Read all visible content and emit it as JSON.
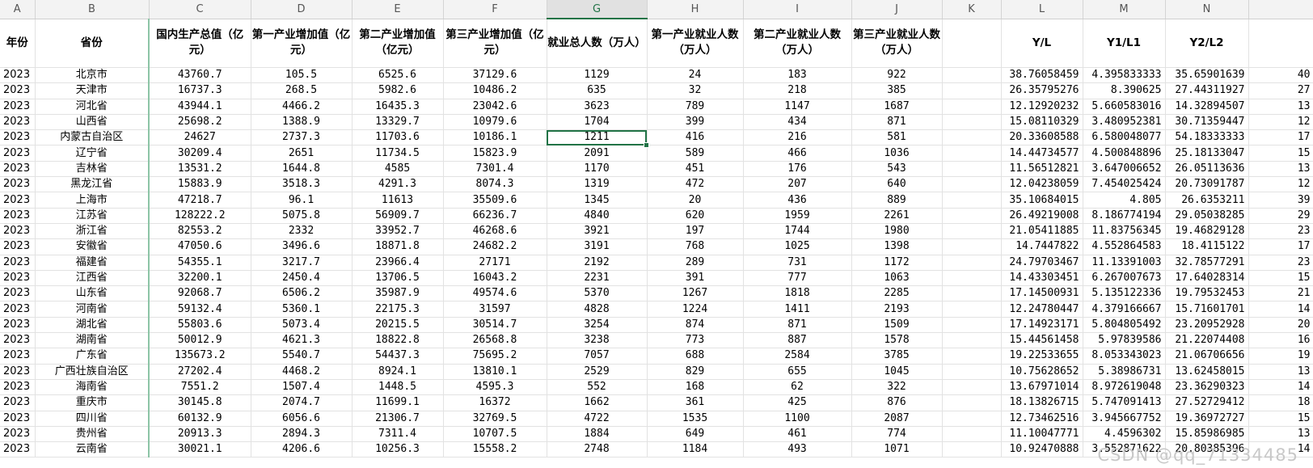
{
  "columns": [
    "A",
    "B",
    "C",
    "D",
    "E",
    "F",
    "G",
    "H",
    "I",
    "J",
    "K",
    "L",
    "M",
    "N"
  ],
  "headers": [
    "年份",
    "省份",
    "国内生产总值（亿元）",
    "第一产业增加值（亿元）",
    "第二产业增加值（亿元）",
    "第三产业增加值（亿元）",
    "就业总人数（万人）",
    "第一产业就业人数（万人）",
    "第二产业就业人数（万人）",
    "第三产业就业人数（万人）",
    "",
    "Y/L",
    "Y1/L1",
    "Y2/L2"
  ],
  "rows": [
    [
      "2023",
      "北京市",
      "43760.7",
      "105.5",
      "6525.6",
      "37129.6",
      "1129",
      "24",
      "183",
      "922",
      "",
      "38.76058459",
      "4.395833333",
      "35.65901639",
      "40"
    ],
    [
      "2023",
      "天津市",
      "16737.3",
      "268.5",
      "5982.6",
      "10486.2",
      "635",
      "32",
      "218",
      "385",
      "",
      "26.35795276",
      "8.390625",
      "27.44311927",
      "27"
    ],
    [
      "2023",
      "河北省",
      "43944.1",
      "4466.2",
      "16435.3",
      "23042.6",
      "3623",
      "789",
      "1147",
      "1687",
      "",
      "12.12920232",
      "5.660583016",
      "14.32894507",
      "13"
    ],
    [
      "2023",
      "山西省",
      "25698.2",
      "1388.9",
      "13329.7",
      "10979.6",
      "1704",
      "399",
      "434",
      "871",
      "",
      "15.08110329",
      "3.480952381",
      "30.71359447",
      "12"
    ],
    [
      "2023",
      "内蒙古自治区",
      "24627",
      "2737.3",
      "11703.6",
      "10186.1",
      "1211",
      "416",
      "216",
      "581",
      "",
      "20.33608588",
      "6.580048077",
      "54.18333333",
      "17"
    ],
    [
      "2023",
      "辽宁省",
      "30209.4",
      "2651",
      "11734.5",
      "15823.9",
      "2091",
      "589",
      "466",
      "1036",
      "",
      "14.44734577",
      "4.500848896",
      "25.18133047",
      "15"
    ],
    [
      "2023",
      "吉林省",
      "13531.2",
      "1644.8",
      "4585",
      "7301.4",
      "1170",
      "451",
      "176",
      "543",
      "",
      "11.56512821",
      "3.647006652",
      "26.05113636",
      "13"
    ],
    [
      "2023",
      "黑龙江省",
      "15883.9",
      "3518.3",
      "4291.3",
      "8074.3",
      "1319",
      "472",
      "207",
      "640",
      "",
      "12.04238059",
      "7.454025424",
      "20.73091787",
      "12"
    ],
    [
      "2023",
      "上海市",
      "47218.7",
      "96.1",
      "11613",
      "35509.6",
      "1345",
      "20",
      "436",
      "889",
      "",
      "35.10684015",
      "4.805",
      "26.6353211",
      "39"
    ],
    [
      "2023",
      "江苏省",
      "128222.2",
      "5075.8",
      "56909.7",
      "66236.7",
      "4840",
      "620",
      "1959",
      "2261",
      "",
      "26.49219008",
      "8.186774194",
      "29.05038285",
      "29"
    ],
    [
      "2023",
      "浙江省",
      "82553.2",
      "2332",
      "33952.7",
      "46268.6",
      "3921",
      "197",
      "1744",
      "1980",
      "",
      "21.05411885",
      "11.83756345",
      "19.46829128",
      "23"
    ],
    [
      "2023",
      "安徽省",
      "47050.6",
      "3496.6",
      "18871.8",
      "24682.2",
      "3191",
      "768",
      "1025",
      "1398",
      "",
      "14.7447822",
      "4.552864583",
      "18.4115122",
      "17"
    ],
    [
      "2023",
      "福建省",
      "54355.1",
      "3217.7",
      "23966.4",
      "27171",
      "2192",
      "289",
      "731",
      "1172",
      "",
      "24.79703467",
      "11.13391003",
      "32.78577291",
      "23"
    ],
    [
      "2023",
      "江西省",
      "32200.1",
      "2450.4",
      "13706.5",
      "16043.2",
      "2231",
      "391",
      "777",
      "1063",
      "",
      "14.43303451",
      "6.267007673",
      "17.64028314",
      "15"
    ],
    [
      "2023",
      "山东省",
      "92068.7",
      "6506.2",
      "35987.9",
      "49574.6",
      "5370",
      "1267",
      "1818",
      "2285",
      "",
      "17.14500931",
      "5.135122336",
      "19.79532453",
      "21"
    ],
    [
      "2023",
      "河南省",
      "59132.4",
      "5360.1",
      "22175.3",
      "31597",
      "4828",
      "1224",
      "1411",
      "2193",
      "",
      "12.24780447",
      "4.379166667",
      "15.71601701",
      "14"
    ],
    [
      "2023",
      "湖北省",
      "55803.6",
      "5073.4",
      "20215.5",
      "30514.7",
      "3254",
      "874",
      "871",
      "1509",
      "",
      "17.14923171",
      "5.804805492",
      "23.20952928",
      "20"
    ],
    [
      "2023",
      "湖南省",
      "50012.9",
      "4621.3",
      "18822.8",
      "26568.8",
      "3238",
      "773",
      "887",
      "1578",
      "",
      "15.44561458",
      "5.97839586",
      "21.22074408",
      "16"
    ],
    [
      "2023",
      "广东省",
      "135673.2",
      "5540.7",
      "54437.3",
      "75695.2",
      "7057",
      "688",
      "2584",
      "3785",
      "",
      "19.22533655",
      "8.053343023",
      "21.06706656",
      "19"
    ],
    [
      "2023",
      "广西壮族自治区",
      "27202.4",
      "4468.2",
      "8924.1",
      "13810.1",
      "2529",
      "829",
      "655",
      "1045",
      "",
      "10.75628652",
      "5.38986731",
      "13.62458015",
      "13"
    ],
    [
      "2023",
      "海南省",
      "7551.2",
      "1507.4",
      "1448.5",
      "4595.3",
      "552",
      "168",
      "62",
      "322",
      "",
      "13.67971014",
      "8.972619048",
      "23.36290323",
      "14"
    ],
    [
      "2023",
      "重庆市",
      "30145.8",
      "2074.7",
      "11699.1",
      "16372",
      "1662",
      "361",
      "425",
      "876",
      "",
      "18.13826715",
      "5.747091413",
      "27.52729412",
      "18"
    ],
    [
      "2023",
      "四川省",
      "60132.9",
      "6056.6",
      "21306.7",
      "32769.5",
      "4722",
      "1535",
      "1100",
      "2087",
      "",
      "12.73462516",
      "3.945667752",
      "19.36972727",
      "15"
    ],
    [
      "2023",
      "贵州省",
      "20913.3",
      "2894.3",
      "7311.4",
      "10707.5",
      "1884",
      "649",
      "461",
      "774",
      "",
      "11.10047771",
      "4.4596302",
      "15.85986985",
      "13"
    ],
    [
      "2023",
      "云南省",
      "30021.1",
      "4206.6",
      "10256.3",
      "15558.2",
      "2748",
      "1184",
      "493",
      "1071",
      "",
      "10.92470888",
      "3.552871622",
      "20.80385396",
      "14"
    ]
  ],
  "selected_cell": "G6",
  "watermark": "CSDN @qq_71334485"
}
